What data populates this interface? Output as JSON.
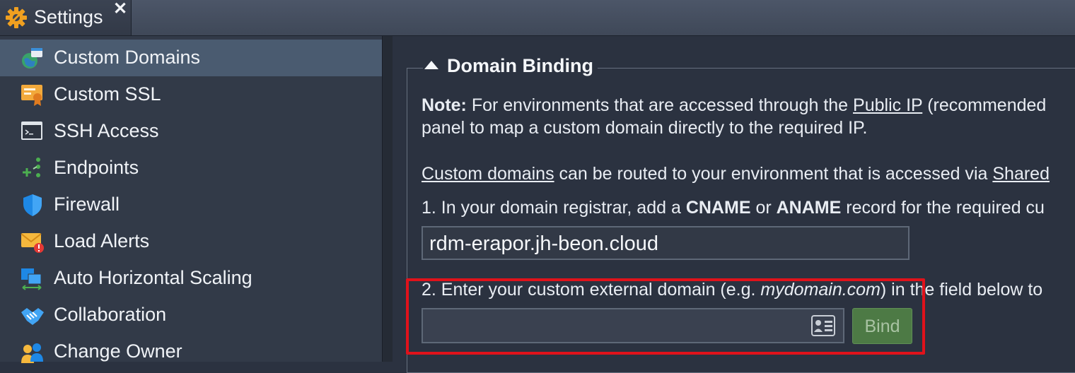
{
  "tab": {
    "title": "Settings",
    "close": "✕",
    "icon": "gear-icon"
  },
  "sidebar": {
    "items": [
      {
        "label": "Custom Domains",
        "icon": "globe-domain-icon",
        "active": true
      },
      {
        "label": "Custom SSL",
        "icon": "certificate-icon",
        "active": false
      },
      {
        "label": "SSH Access",
        "icon": "terminal-icon",
        "active": false
      },
      {
        "label": "Endpoints",
        "icon": "endpoints-icon",
        "active": false
      },
      {
        "label": "Firewall",
        "icon": "shield-icon",
        "active": false
      },
      {
        "label": "Load Alerts",
        "icon": "alert-envelope-icon",
        "active": false
      },
      {
        "label": "Auto Horizontal Scaling",
        "icon": "scaling-icon",
        "active": false
      },
      {
        "label": "Collaboration",
        "icon": "handshake-icon",
        "active": false
      },
      {
        "label": "Change Owner",
        "icon": "users-icon",
        "active": false
      }
    ]
  },
  "section": {
    "title": "Domain Binding",
    "note_label": "Note:",
    "note_text1": " For environments that are accessed through the ",
    "note_link": "Public IP",
    "note_text2": " (recommended",
    "note_line2": "panel to map a custom domain directly to the required IP.",
    "cd_link": "Custom domains",
    "cd_text": " can be routed to your environment that is accessed via ",
    "cd_link2": "Shared",
    "step1_a": "1. In your domain registrar, add a ",
    "step1_b": "CNAME",
    "step1_c": " or ",
    "step1_d": "ANAME",
    "step1_e": " record for the required cu",
    "cname_value": "rdm-erapor.jh-beon.cloud",
    "step2_a": "2. Enter your custom external domain (e.g. ",
    "step2_b": "mydomain.com",
    "step2_c": ") in the field below to",
    "domain_input_value": "",
    "bind_label": "Bind"
  },
  "colors": {
    "highlight": "#e0121b",
    "bind_button": "#4d7a45",
    "active_item": "#4a5b70"
  }
}
